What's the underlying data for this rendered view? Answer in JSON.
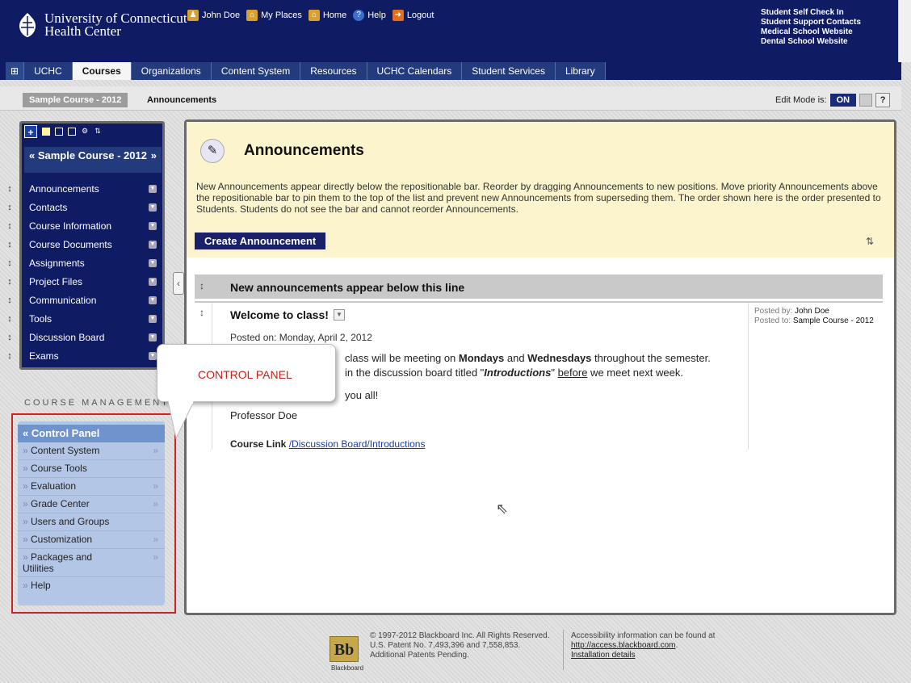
{
  "header": {
    "logo_line1": "University of Connecticut",
    "logo_line2": "Health Center",
    "topnav": [
      {
        "label": "John Doe",
        "icon": "user-icon"
      },
      {
        "label": "My Places",
        "icon": "places-icon"
      },
      {
        "label": "Home",
        "icon": "home-icon"
      },
      {
        "label": "Help",
        "icon": "help-icon"
      },
      {
        "label": "Logout",
        "icon": "logout-icon"
      }
    ],
    "quicklinks": [
      "Student Self Check In",
      "Student Support Contacts",
      "Medical School Website",
      "Dental School Website"
    ]
  },
  "tabs": [
    "UCHC",
    "Courses",
    "Organizations",
    "Content System",
    "Resources",
    "UCHC Calendars",
    "Student Services",
    "Library"
  ],
  "breadcrumb": {
    "course": "Sample Course - 2012",
    "page": "Announcements"
  },
  "edit_mode": {
    "label": "Edit Mode is:",
    "state": "ON",
    "help": "?"
  },
  "course_menu": {
    "title": "Sample Course - 2012",
    "items": [
      "Announcements",
      "Contacts",
      "Course Information",
      "Course Documents",
      "Assignments",
      "Project Files",
      "Communication",
      "Tools",
      "Discussion Board",
      "Exams"
    ]
  },
  "course_management": {
    "label": "COURSE MANAGEMENT",
    "control_panel": "Control Panel",
    "items": [
      {
        "label": "Content System",
        "expand": true
      },
      {
        "label": "Course Tools",
        "expand": false
      },
      {
        "label": "Evaluation",
        "expand": true
      },
      {
        "label": "Grade Center",
        "expand": true
      },
      {
        "label": "Users and Groups",
        "expand": false
      },
      {
        "label": "Customization",
        "expand": true
      },
      {
        "label": "Packages and Utilities",
        "expand": true
      },
      {
        "label": "Help",
        "expand": false
      }
    ]
  },
  "callout": {
    "text": "CONTROL PANEL"
  },
  "page": {
    "title": "Announcements",
    "description": "New Announcements appear directly below the repositionable bar. Reorder by dragging Announcements to new positions. Move priority Announcements above the repositionable bar to pin them to the top of the list and prevent new Announcements from superseding them. The order shown here is the order presented to Students. Students do not see the bar and cannot reorder Announcements.",
    "create_button": "Create Announcement",
    "reposition_bar": "New announcements appear below this line"
  },
  "announcement": {
    "title": "Welcome to class!",
    "posted_on": "Posted on: Monday, April 2, 2012",
    "body_line1_pre": "class will be meeting on ",
    "body_bold1": "Mondays",
    "body_and": " and ",
    "body_bold2": "Wednesdays",
    "body_line1_post": " throughout the semester.",
    "body_line2_pre": "in the discussion board titled \"",
    "body_bold3": "Introductions",
    "body_line2_mid": "\" ",
    "body_under": "before",
    "body_line2_post": " we meet next week.",
    "body_line3": "you all!",
    "signature": "Professor Doe",
    "link_label": "Course Link",
    "link_text": "/Discussion Board/Introductions",
    "posted_by_label": "Posted by:",
    "posted_by": "John Doe",
    "posted_to_label": "Posted to:",
    "posted_to": "Sample Course - 2012"
  },
  "footer": {
    "logo_text": "Bb",
    "logo_label": "Blackboard",
    "copyright": "© 1997-2012 Blackboard Inc. All Rights Reserved. U.S. Patent No. 7,493,396 and 7,558,853. Additional Patents Pending.",
    "access_text": "Accessibility information can be found at",
    "access_link": "http://access.blackboard.com",
    "install_link": "Installation details"
  },
  "colors": {
    "header_bg": "#0f1b63",
    "accent": "#1a216a",
    "callout_text": "#c0241a",
    "frame_red": "#cc2222"
  }
}
